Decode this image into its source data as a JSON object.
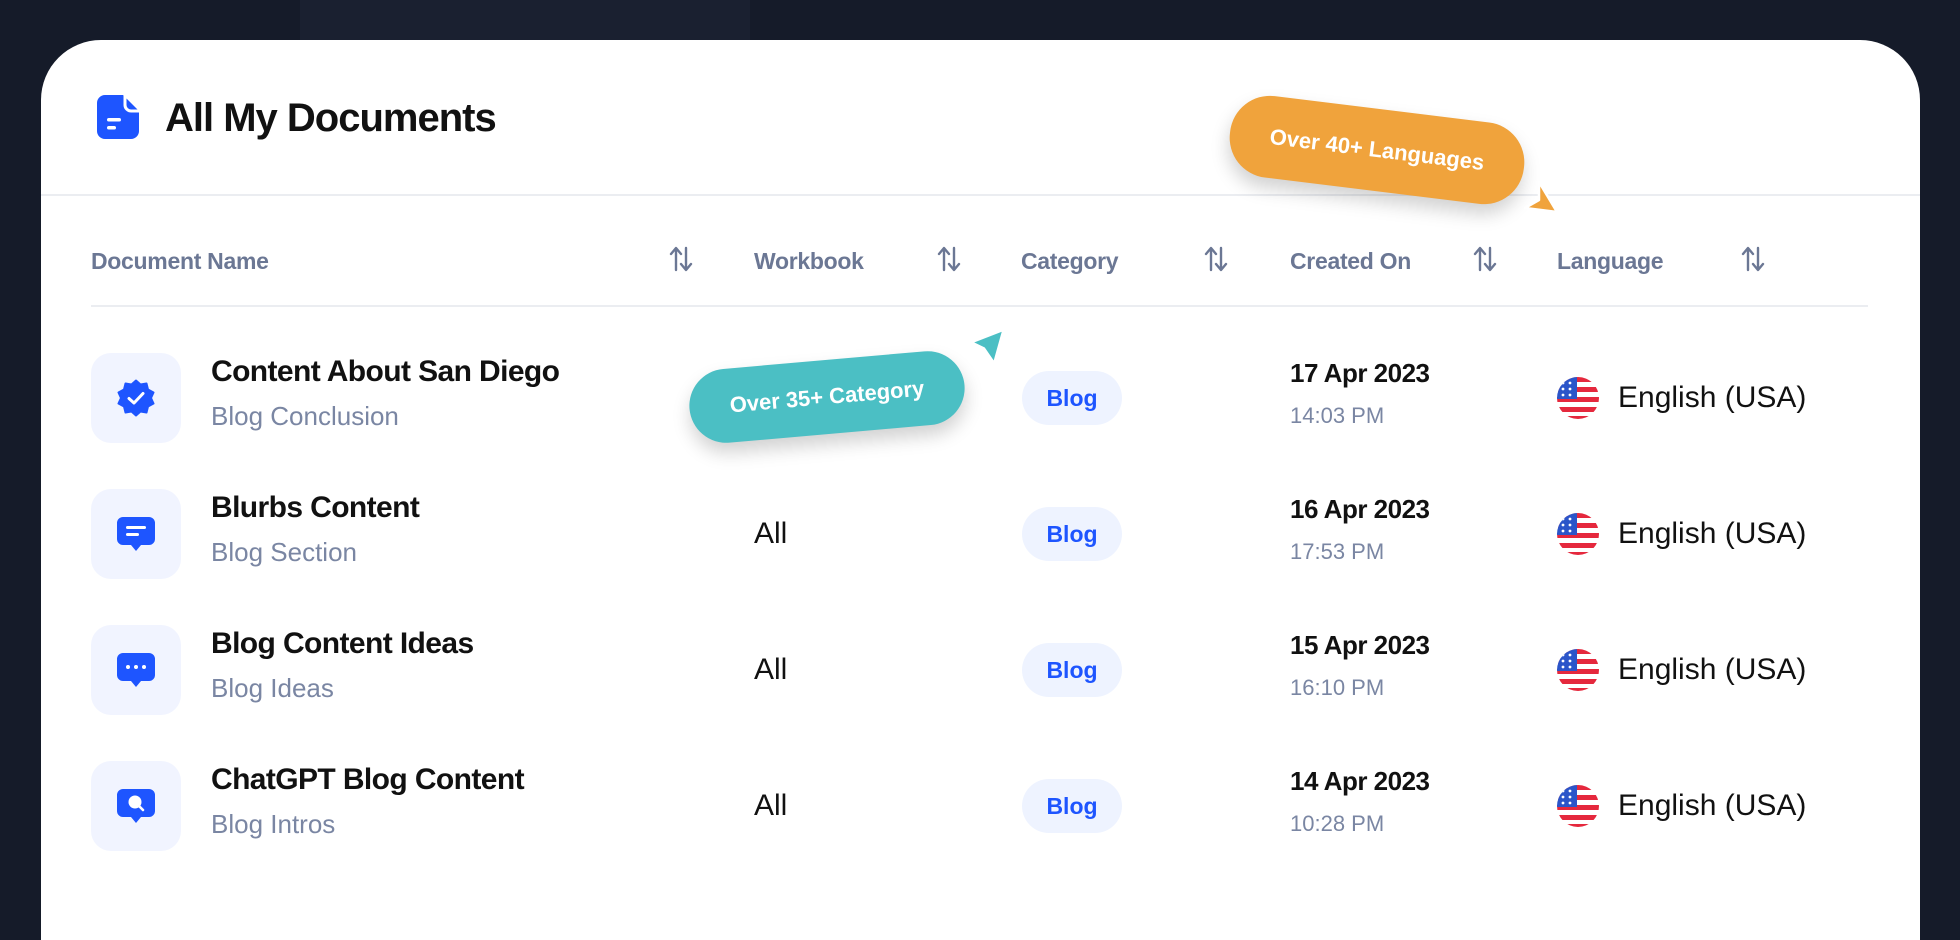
{
  "header": {
    "title": "All My Documents",
    "icon": "document-icon"
  },
  "table": {
    "columns": [
      {
        "label": "Document Name",
        "sortable": true
      },
      {
        "label": "Workbook",
        "sortable": true
      },
      {
        "label": "Category",
        "sortable": true
      },
      {
        "label": "Created On",
        "sortable": true
      },
      {
        "label": "Language",
        "sortable": true
      }
    ],
    "rows": [
      {
        "icon": "verified-badge-icon",
        "name": "Content About San Diego",
        "subtitle": "Blog Conclusion",
        "workbook": "",
        "category": "Blog",
        "date": "17 Apr 2023",
        "time": "14:03 PM",
        "language": "English (USA)",
        "flag": "us-flag-icon"
      },
      {
        "icon": "chat-lines-icon",
        "name": "Blurbs Content",
        "subtitle": "Blog Section",
        "workbook": "All",
        "category": "Blog",
        "date": "16 Apr 2023",
        "time": "17:53 PM",
        "language": "English (USA)",
        "flag": "us-flag-icon"
      },
      {
        "icon": "chat-dots-icon",
        "name": "Blog Content Ideas",
        "subtitle": "Blog Ideas",
        "workbook": "All",
        "category": "Blog",
        "date": "15 Apr 2023",
        "time": "16:10 PM",
        "language": "English (USA)",
        "flag": "us-flag-icon"
      },
      {
        "icon": "chat-search-icon",
        "name": "ChatGPT Blog Content",
        "subtitle": "Blog Intros",
        "workbook": "All",
        "category": "Blog",
        "date": "14 Apr 2023",
        "time": "10:28 PM",
        "language": "English (USA)",
        "flag": "us-flag-icon"
      }
    ]
  },
  "callouts": {
    "category": "Over 35+ Category",
    "languages": "Over 40+ Languages"
  },
  "colors": {
    "accent": "#1e55ff",
    "pill_bg": "#eef3ff",
    "icon_box_bg": "#f1f4ff",
    "header_text": "#6b7794",
    "muted_text": "#7a86a3",
    "teal_callout": "#4bbfc4",
    "orange_callout": "#f0a33c",
    "bezel": "#151b29"
  }
}
